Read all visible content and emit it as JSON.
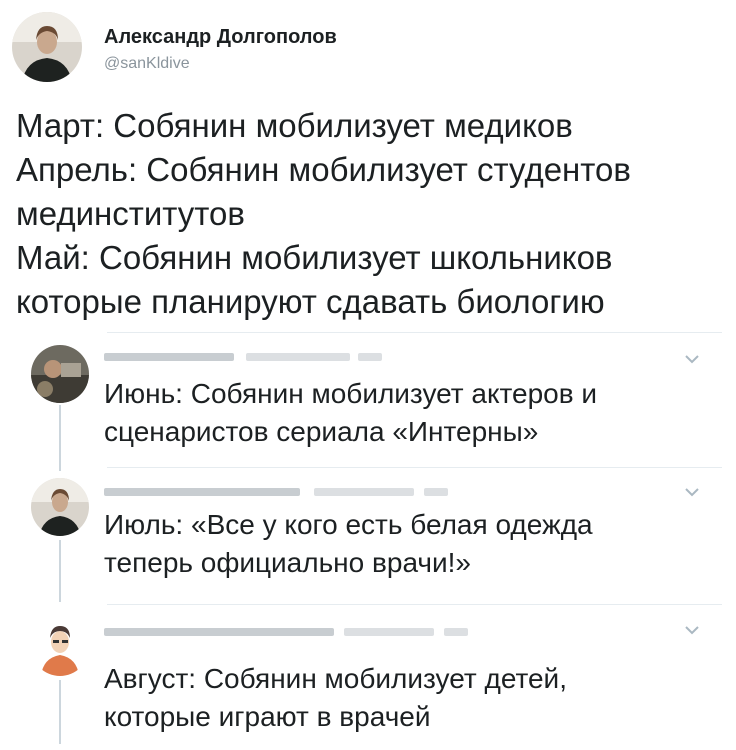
{
  "author": {
    "name": "Александр Долгополов",
    "handle": "@sanKldive"
  },
  "tweet": {
    "lines": [
      "Март: Собянин мобилизует медиков",
      "Апрель: Собянин мобилизует студентов",
      "мединститутов",
      "Май: Собянин мобилизует школьников",
      "которые планируют сдавать биологию"
    ]
  },
  "replies": [
    {
      "lines": [
        "Июнь: Собянин мобилизует актеров и",
        "сценаристов сериала «Интерны»"
      ]
    },
    {
      "lines": [
        "Июль: «Все у кого есть белая одежда",
        "теперь официально врачи!»"
      ]
    },
    {
      "lines": [
        "Август: Собянин мобилизует детей,",
        "которые играют в врачей"
      ]
    }
  ],
  "icons": {
    "chevron": "chevron-down-icon",
    "avatar": "avatar"
  },
  "colors": {
    "text": "#1c2022",
    "secondary": "#8a949c",
    "divider": "#e6ecf0",
    "thread": "#ccd6dd"
  }
}
